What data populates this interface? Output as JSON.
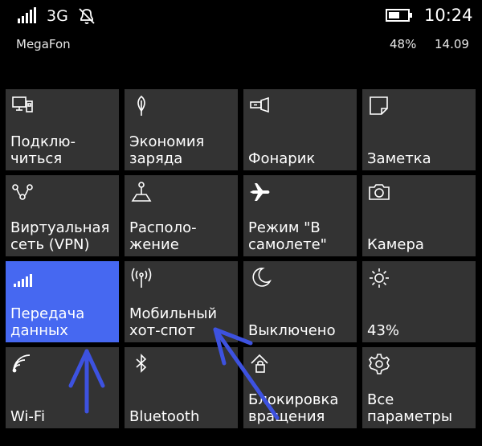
{
  "status": {
    "network": "3G",
    "carrier": "MegaFon",
    "battery_percent": "48%",
    "time": "10:24",
    "date": "14.09"
  },
  "colors": {
    "tile": "#333333",
    "tile_active": "#4668f1",
    "annotation_arrow": "#3d52e0"
  },
  "tiles": [
    {
      "label": "Подклю-\nчиться",
      "icon": "connect-icon",
      "active": false
    },
    {
      "label": "Экономия\nзаряда",
      "icon": "battery-saver-icon",
      "active": false
    },
    {
      "label": "Фонарик",
      "icon": "flashlight-icon",
      "active": false
    },
    {
      "label": "Заметка",
      "icon": "note-icon",
      "active": false
    },
    {
      "label": "Виртуальная\nсеть (VPN)",
      "icon": "vpn-icon",
      "active": false
    },
    {
      "label": "Располо-\nжение",
      "icon": "location-icon",
      "active": false
    },
    {
      "label": "Режим \"В\nсамолете\"",
      "icon": "airplane-icon",
      "active": false
    },
    {
      "label": "Камера",
      "icon": "camera-icon",
      "active": false
    },
    {
      "label": "Передача\nданных",
      "icon": "cellular-data-icon",
      "active": true
    },
    {
      "label": "Мобильный\nхот-спот",
      "icon": "hotspot-icon",
      "active": false
    },
    {
      "label": "Выключено",
      "icon": "moon-icon",
      "active": false
    },
    {
      "label": "43%",
      "icon": "brightness-icon",
      "active": false
    },
    {
      "label": "Wi-Fi",
      "icon": "wifi-icon",
      "active": false
    },
    {
      "label": "Bluetooth",
      "icon": "bluetooth-icon",
      "active": false
    },
    {
      "label": "Блокировка\nвращения",
      "icon": "rotation-lock-icon",
      "active": false
    },
    {
      "label": "Все\nпараметры",
      "icon": "gear-icon",
      "active": false
    }
  ]
}
